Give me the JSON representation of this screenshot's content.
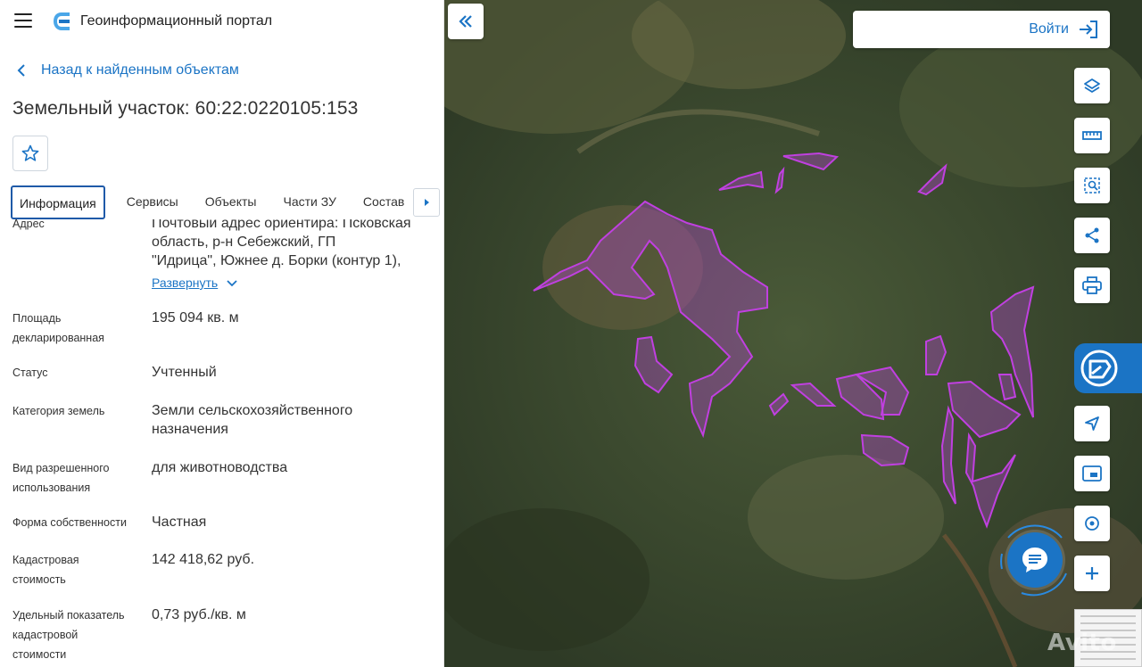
{
  "header": {
    "title": "Геоинформационный портал"
  },
  "nav": {
    "back_label": "Назад к найденным объектам"
  },
  "object": {
    "title": "Земельный участок: 60:22:0220105:153"
  },
  "tabs": [
    {
      "label": "Информация",
      "active": true
    },
    {
      "label": "Сервисы"
    },
    {
      "label": "Объекты"
    },
    {
      "label": "Части ЗУ"
    },
    {
      "label": "Состав"
    }
  ],
  "info": {
    "address": {
      "label": "Адрес",
      "value_line1": "Почтовый адрес ориентира: Псковская",
      "value_line2": "область, р-н Себежский, ГП",
      "value_line3": "\"Идрица\", Южнее д. Борки (контур 1),",
      "expand_label": "Развернуть"
    },
    "area": {
      "label_line1": "Площадь",
      "label_line2": "декларированная",
      "value": "195 094 кв. м"
    },
    "status": {
      "label": "Статус",
      "value": "Учтенный"
    },
    "category": {
      "label": "Категория земель",
      "value_line1": "Земли сельскохозяйственного",
      "value_line2": "назначения"
    },
    "permitted_use": {
      "label_line1": "Вид разрешенного",
      "label_line2": "использования",
      "value": "для животноводства"
    },
    "ownership": {
      "label": "Форма собственности",
      "value": "Частная"
    },
    "cadastral_value": {
      "label_line1": "Кадастровая",
      "label_line2": "стоимость",
      "value": "142 418,62 руб."
    },
    "specific_index": {
      "label_line1": "Удельный показатель",
      "label_line2": "кадастровой",
      "label_line3": "стоимости",
      "value": "0,73 руб./кв. м"
    }
  },
  "map": {
    "login_label": "Войти",
    "watermark": "Avito",
    "tools": [
      "layers-icon",
      "ruler-icon",
      "select-area-icon",
      "share-icon",
      "print-icon",
      "navigate-icon",
      "minimap-icon",
      "location-icon",
      "plus-icon"
    ],
    "accent_color": "#1b74c5",
    "parcel_color": "#c040e0"
  }
}
